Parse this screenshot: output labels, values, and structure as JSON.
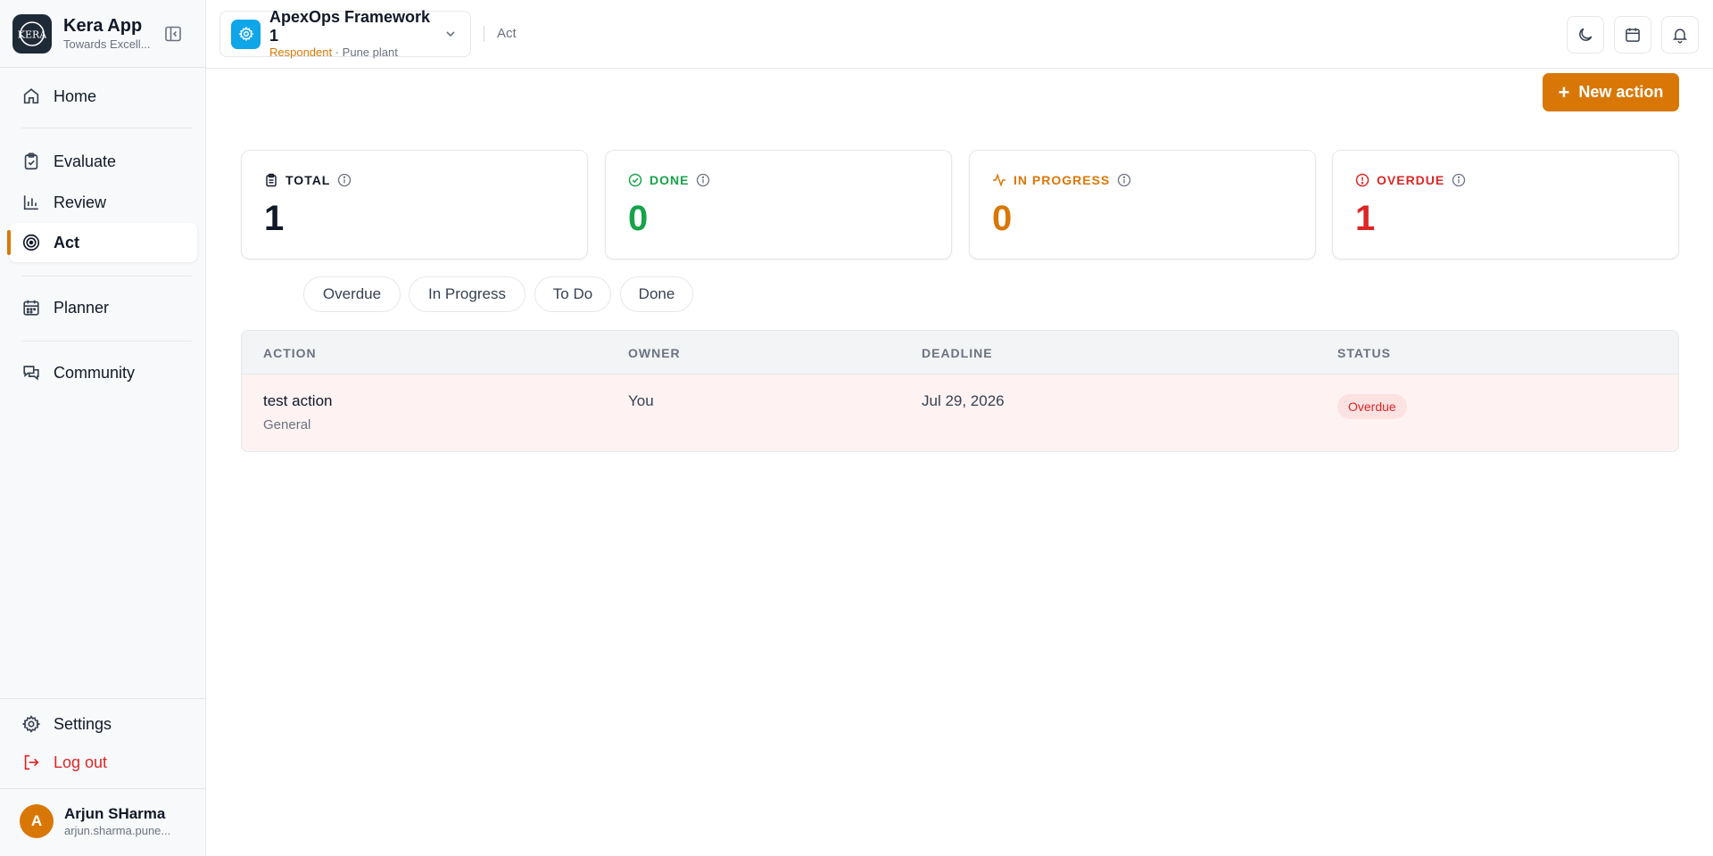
{
  "brand": {
    "name": "Kera App",
    "subtitle": "Towards Excell..."
  },
  "sidebar": {
    "items": [
      {
        "label": "Home",
        "icon": "home-icon"
      },
      {
        "label": "Evaluate",
        "icon": "clipboard-check-icon"
      },
      {
        "label": "Review",
        "icon": "bar-chart-icon"
      },
      {
        "label": "Act",
        "icon": "target-icon",
        "active": true
      },
      {
        "label": "Planner",
        "icon": "calendar-icon"
      },
      {
        "label": "Community",
        "icon": "chat-icon"
      }
    ],
    "settings_label": "Settings",
    "logout_label": "Log out"
  },
  "user": {
    "initial": "A",
    "name": "Arjun SHarma",
    "email": "arjun.sharma.pune..."
  },
  "header": {
    "org_name": "ApexOps Framework 1",
    "org_role": "Respondent",
    "org_meta": " · Pune plant",
    "breadcrumb": "Act"
  },
  "main": {
    "new_action_label": "New action",
    "stats": [
      {
        "label": "TOTAL",
        "value": "1",
        "color": "#111827"
      },
      {
        "label": "DONE",
        "value": "0",
        "color": "#16a34a"
      },
      {
        "label": "IN PROGRESS",
        "value": "0",
        "color": "#d97706"
      },
      {
        "label": "OVERDUE",
        "value": "1",
        "color": "#dc2626"
      }
    ],
    "filters": [
      "Overdue",
      "In Progress",
      "To Do",
      "Done"
    ],
    "table": {
      "columns": [
        "ACTION",
        "OWNER",
        "DEADLINE",
        "STATUS"
      ],
      "rows": [
        {
          "action": "test action",
          "category": "General",
          "owner": "You",
          "deadline": "Jul 29, 2026",
          "status": "Overdue"
        }
      ]
    }
  },
  "colors": {
    "accent": "#d97706",
    "overdue": "#dc2626",
    "done": "#16a34a",
    "org_icon": "#0ea5e9"
  }
}
